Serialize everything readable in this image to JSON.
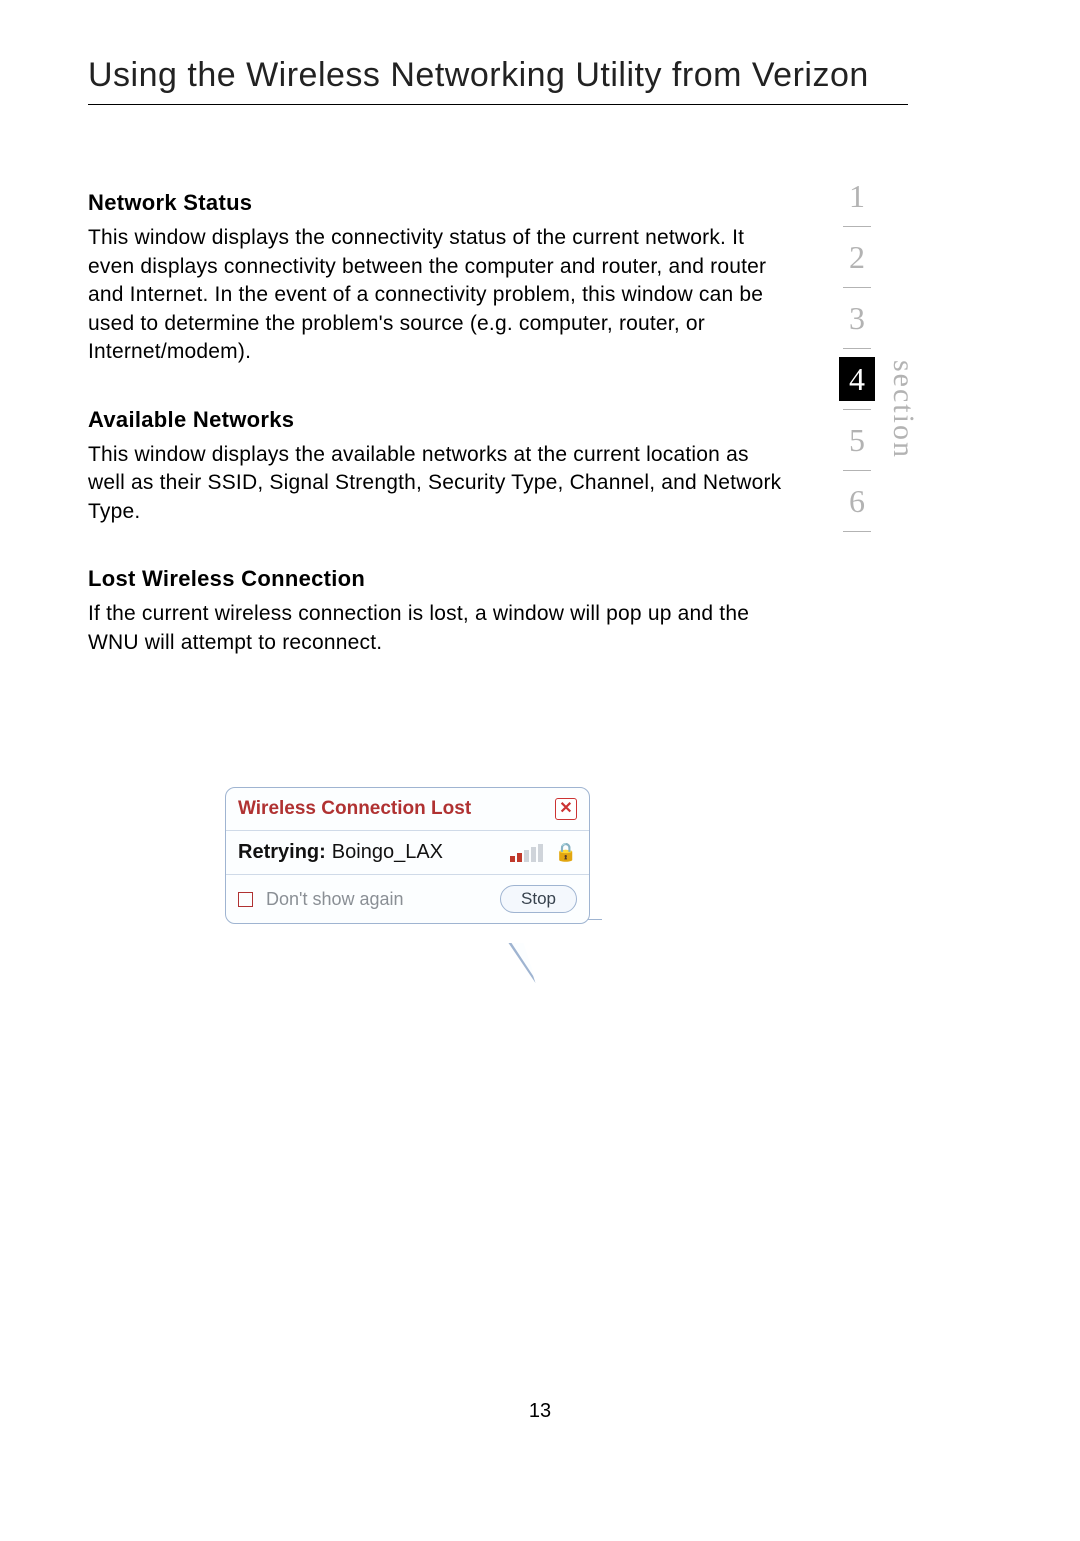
{
  "page": {
    "title": "Using the Wireless Networking Utility from Verizon",
    "number": "13"
  },
  "sections": [
    {
      "heading": "Network Status",
      "body": "This window displays the connectivity status of the current network. It even displays connectivity between the computer and router, and router and Internet. In the event of a connectivity problem, this window can be used to determine the problem's source (e.g. computer, router, or Internet/modem)."
    },
    {
      "heading": "Available Networks",
      "body": "This window displays the available networks at the current location as well as their SSID, Signal Strength, Security Type, Channel, and Network Type."
    },
    {
      "heading": "Lost Wireless Connection",
      "body": "If the current wireless connection is lost, a window will pop up and the WNU will attempt to reconnect."
    }
  ],
  "section_nav": {
    "label": "section",
    "items": [
      "1",
      "2",
      "3",
      "4",
      "5",
      "6"
    ],
    "active_index": 3
  },
  "popup": {
    "title": "Wireless Connection Lost",
    "close_glyph": "✕",
    "retry_prefix": "Retrying:",
    "retry_ssid": "Boingo_LAX",
    "lock_glyph": "🔒",
    "dont_show_label": "Don't show again",
    "stop_label": "Stop"
  }
}
